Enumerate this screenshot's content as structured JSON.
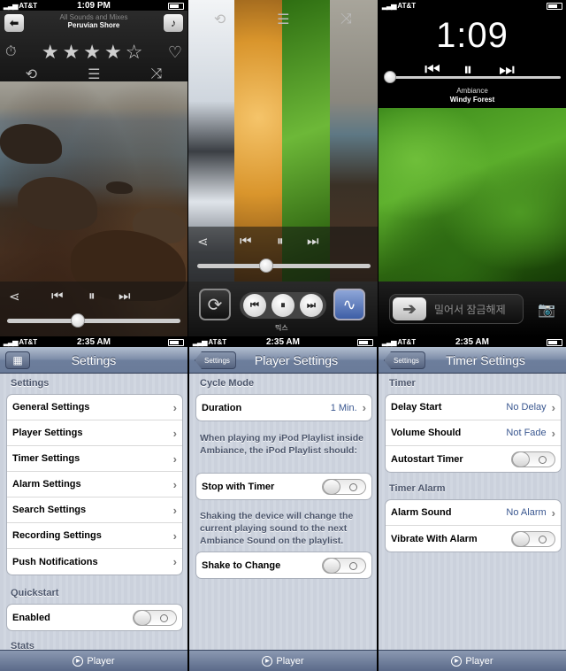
{
  "status": {
    "pane1": {
      "carrier": "AT&T",
      "time": "1:09 PM"
    },
    "lower": {
      "carrier": "AT&T",
      "time": "2:35 AM"
    }
  },
  "player1": {
    "subtitle": "All Sounds and Mixes",
    "title": "Peruvian Shore",
    "back_icon": "back-arrow-icon",
    "music_icon": "music-note-icon",
    "rating": 4
  },
  "player2": {
    "mix_label": "믹스"
  },
  "lockscreen": {
    "clock": "1:09",
    "sound_category": "Ambiance",
    "sound_name": "Windy Forest",
    "unlock_text": "밀어서 잠금해제"
  },
  "settings": {
    "nav_title": "Settings",
    "section_settings": "Settings",
    "items": [
      "General Settings",
      "Player Settings",
      "Timer Settings",
      "Alarm Settings",
      "Search Settings",
      "Recording Settings",
      "Push Notifications"
    ],
    "section_quickstart": "Quickstart",
    "enabled_label": "Enabled",
    "section_stats": "Stats",
    "tab_label": "Player"
  },
  "player_settings": {
    "back_label": "Settings",
    "nav_title": "Player Settings",
    "section_cycle": "Cycle Mode",
    "duration_label": "Duration",
    "duration_value": "1 Min.",
    "note_playlist": "When playing my iPod Playlist inside Ambiance, the iPod Playlist should:",
    "stop_timer_label": "Stop with Timer",
    "note_shake": "Shaking the device will change the current playing sound to the next Ambiance Sound on the playlist.",
    "shake_label": "Shake to Change",
    "tab_label": "Player"
  },
  "timer_settings": {
    "back_label": "Settings",
    "nav_title": "Timer Settings",
    "section_timer": "Timer",
    "delay_label": "Delay Start",
    "delay_value": "No Delay",
    "volume_label": "Volume Should",
    "volume_value": "Not Fade",
    "autostart_label": "Autostart Timer",
    "section_alarm": "Timer Alarm",
    "alarm_sound_label": "Alarm Sound",
    "alarm_sound_value": "No Alarm",
    "vibrate_label": "Vibrate With Alarm",
    "tab_label": "Player"
  }
}
